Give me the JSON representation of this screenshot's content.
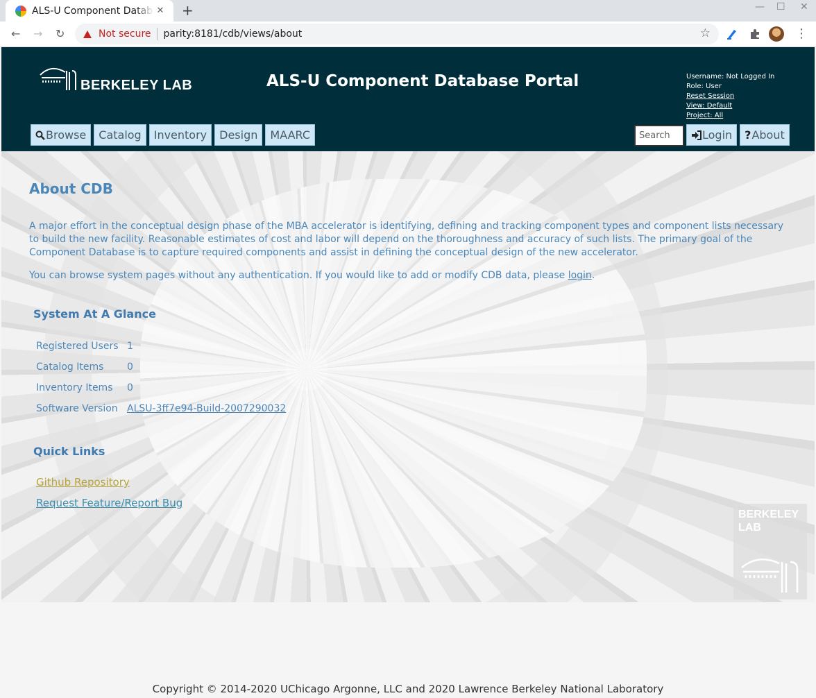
{
  "browser": {
    "tab_title": "ALS-U Component Database Portal",
    "security_label": "Not secure",
    "url": "parity:8181/cdb/views/about"
  },
  "header": {
    "logo_text": "BERKELEY LAB",
    "portal_title": "ALS-U Component Database Portal",
    "user": {
      "username": "Username: Not Logged In",
      "role": "Role: User",
      "reset_session": "Reset Session",
      "view": "View: Default",
      "project": "Project: All"
    },
    "menu": {
      "browse": "Browse",
      "catalog": "Catalog",
      "inventory": "Inventory",
      "design": "Design",
      "maarc": "MAARC"
    },
    "search_placeholder": "Search",
    "login": "Login",
    "about": "About"
  },
  "about": {
    "title": "About CDB",
    "paragraph1": "A major effort in the conceptual design phase of the MBA accelerator is identifying, defining and tracking component types and component lists necessary to build the new facility. Reasonable estimates of cost and labor will depend on the thoroughness and accuracy of such lists. The primary goal of the Component Database is to capture required components and assist in defining the conceptual design of the new accelerator.",
    "paragraph2_prefix": "You can browse system pages without any authentication. If you would like to add or modify CDB data, please ",
    "paragraph2_link": "login",
    "paragraph2_suffix": "."
  },
  "glance": {
    "title": "System At A Glance",
    "rows": [
      {
        "label": "Registered Users",
        "value": "1"
      },
      {
        "label": "Catalog Items",
        "value": "0"
      },
      {
        "label": "Inventory Items",
        "value": "0"
      },
      {
        "label": "Software Version",
        "value": "ALSU-3ff7e94-Build-2007290032"
      }
    ]
  },
  "quick_links": {
    "title": "Quick Links",
    "github": "Github Repository",
    "bug": "Request Feature/Report Bug"
  },
  "corner_logo": {
    "line1": "BERKELEY",
    "line2": "LAB"
  },
  "footer": {
    "copyright": "Copyright © 2014-2020 UChicago Argonne, LLC and 2020 Lawrence Berkeley National Laboratory"
  },
  "colors": {
    "header_bg": "#002e3a",
    "accent_text": "#4a86b8",
    "menu_button_bg": "#cfe8f7",
    "github_link": "#b8a43a",
    "bug_link": "#3c8fb0",
    "warning": "#c5221f"
  }
}
